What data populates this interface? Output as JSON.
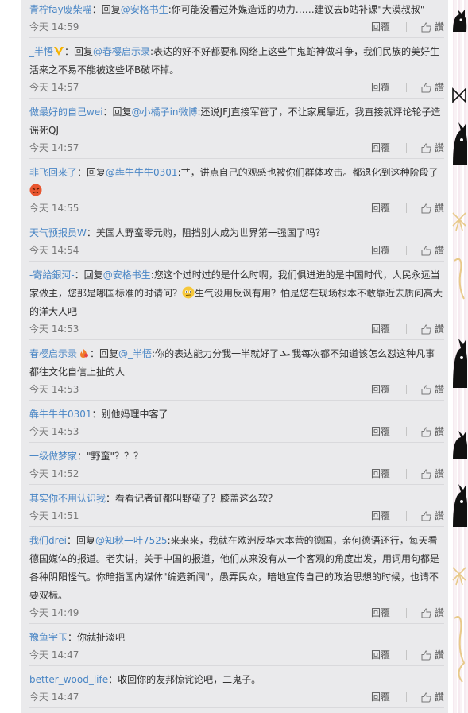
{
  "actions": {
    "reply_label": "回覆",
    "like_label": "讚"
  },
  "comments": [
    {
      "user": "青柠fay废柴喵",
      "badge": null,
      "segments": [
        {
          "t": "：",
          "c": "colon"
        },
        {
          "t": "回复",
          "c": "text"
        },
        {
          "t": "@安格书生",
          "c": "mention"
        },
        {
          "t": ":你可能没看过外媒造谣的功力……建议去b站补课\"大漠叔叔\"",
          "c": "text"
        }
      ],
      "time": "今天 14:59"
    },
    {
      "user": "_半悟",
      "badge": "v-badge",
      "segments": [
        {
          "t": "：回复",
          "c": "text"
        },
        {
          "t": "@春樱启示录",
          "c": "mention"
        },
        {
          "t": ":表达的好不好都要和网络上这些牛鬼蛇神做斗争，我们民族的美好生活来之不易不能被这些坏B破坏掉。",
          "c": "text"
        }
      ],
      "time": "今天 14:57"
    },
    {
      "user": "做最好的自己wei",
      "badge": null,
      "segments": [
        {
          "t": "：回复",
          "c": "text"
        },
        {
          "t": "@小橘子in微博",
          "c": "mention"
        },
        {
          "t": ":还说JFJ直接军管了，不让家属靠近，我直接就评论轮子造谣死QJ",
          "c": "text"
        }
      ],
      "time": "今天 14:57"
    },
    {
      "user": "非飞回来了",
      "badge": null,
      "segments": [
        {
          "t": "：回复",
          "c": "text"
        },
        {
          "t": "@犇牛牛牛0301",
          "c": "mention"
        },
        {
          "t": ":艹，讲点自己的观感也被你们群体攻击。都退化到这种阶段了",
          "c": "text"
        },
        {
          "t": "angry-face-emoji",
          "c": "emoji"
        }
      ],
      "time": "今天 14:55"
    },
    {
      "user": "天气预报员W",
      "badge": null,
      "segments": [
        {
          "t": "：美国人野蛮零元购，阻挡别人成为世界第一强国了吗？",
          "c": "text"
        }
      ],
      "time": "今天 14:54"
    },
    {
      "user": "-寄給銀河-",
      "badge": null,
      "segments": [
        {
          "t": "：回复",
          "c": "text"
        },
        {
          "t": "@安格书生",
          "c": "mention"
        },
        {
          "t": ":您这个过时过的是什么时啊，我们俱进进的是中国时代，人民永远当家做主，您那是哪国标准的时请问？",
          "c": "text"
        },
        {
          "t": "confused-face-emoji",
          "c": "emoji"
        },
        {
          "t": "生气没用反讽有用？怕是您在现场根本不敢靠近去质问高大的洋大人吧",
          "c": "text"
        }
      ],
      "time": "今天 14:53"
    },
    {
      "user": "春樱启示录",
      "badge": "fire-badge",
      "segments": [
        {
          "t": "：回复",
          "c": "text"
        },
        {
          "t": "@_半悟",
          "c": "mention"
        },
        {
          "t": ":你的表达能力分我一半就好了",
          "c": "text"
        },
        {
          "t": "plane-emoji",
          "c": "emoji"
        },
        {
          "t": "我每次都不知道该怎么怼这种凡事都往文化自信上扯的人",
          "c": "text"
        }
      ],
      "time": "今天 14:53"
    },
    {
      "user": "犇牛牛牛0301",
      "badge": null,
      "segments": [
        {
          "t": "：别他妈理中客了",
          "c": "text"
        }
      ],
      "time": "今天 14:53"
    },
    {
      "user": "一级做梦家",
      "badge": null,
      "segments": [
        {
          "t": "：\"野蛮\"？？？",
          "c": "text"
        }
      ],
      "time": "今天 14:52"
    },
    {
      "user": "其实你不用认识我",
      "badge": null,
      "segments": [
        {
          "t": "：看看记者证都叫野蛮了？膝盖这么软？",
          "c": "text"
        }
      ],
      "time": "今天 14:51"
    },
    {
      "user": "我们drei",
      "badge": null,
      "segments": [
        {
          "t": "：回复",
          "c": "text"
        },
        {
          "t": "@知秋一叶7525",
          "c": "mention"
        },
        {
          "t": ":来来来，我就在欧洲反华大本营的德国，亲何德语还行，每天看德国媒体的报道。老实讲，关于中国的报道，他们从来没有从一个客观的角度出发，用词用句都是各种阴阳怪气。你暗指国内媒体\"编造新闻\"，愚弄民众，暗地宣传自己的政治思想的时候，也请不要双标。",
          "c": "text"
        }
      ],
      "time": "今天 14:49"
    },
    {
      "user": "豫鱼宇玉",
      "badge": null,
      "segments": [
        {
          "t": "：你就扯淡吧",
          "c": "text"
        }
      ],
      "time": "今天 14:47"
    },
    {
      "user": "better_wood_life",
      "badge": null,
      "segments": [
        {
          "t": "：收回你的友邦惊诧论吧，二鬼子。",
          "c": "text"
        }
      ],
      "time": "今天 14:47"
    }
  ],
  "colors": {
    "link": "#4a86c5",
    "panel_bg": "#eaeaec",
    "text": "#333333",
    "meta": "#777777"
  }
}
